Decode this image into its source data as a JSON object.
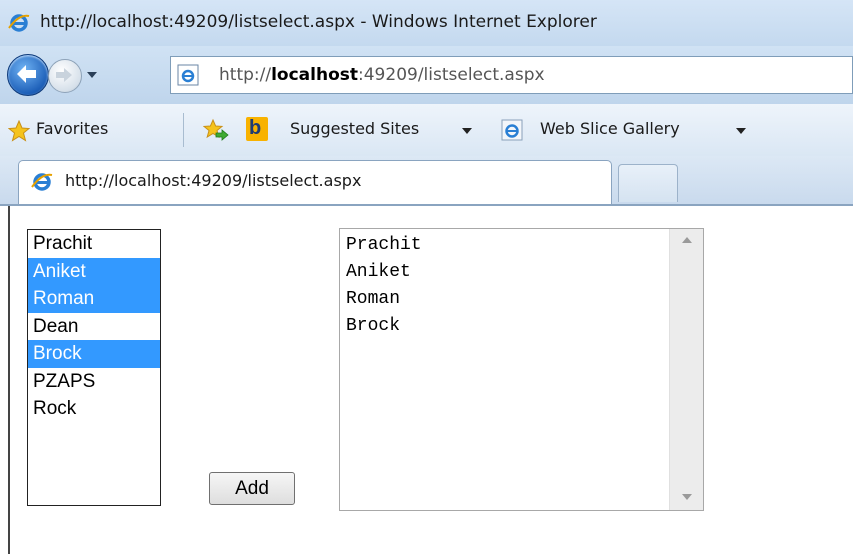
{
  "window": {
    "title": "http://localhost:49209/listselect.aspx - Windows Internet Explorer"
  },
  "address_bar": {
    "url_prefix": "http://",
    "url_host": "localhost",
    "url_suffix": ":49209/listselect.aspx"
  },
  "favorites_bar": {
    "favorites_label": "Favorites",
    "suggested_sites_label": "Suggested Sites",
    "web_slice_label": "Web Slice Gallery"
  },
  "tabs": [
    {
      "label": "http://localhost:49209/listselect.aspx",
      "active": true
    }
  ],
  "page": {
    "listbox": {
      "options": [
        {
          "label": "Prachit",
          "selected": false
        },
        {
          "label": "Aniket",
          "selected": true
        },
        {
          "label": "Roman",
          "selected": true
        },
        {
          "label": "Dean",
          "selected": false
        },
        {
          "label": "Brock",
          "selected": true
        },
        {
          "label": "PZAPS",
          "selected": false
        },
        {
          "label": "Rock",
          "selected": false
        }
      ]
    },
    "add_button_label": "Add",
    "textarea_lines": [
      "Prachit",
      "Aniket",
      "Roman",
      "Brock"
    ]
  },
  "colors": {
    "selection": "#3399ff",
    "title_bar": "#c4d9ef",
    "back_button": "#1d5fb8"
  },
  "icons": {
    "title": "ie-icon",
    "back": "back-arrow-icon",
    "forward": "forward-arrow-icon",
    "favorites": "star-icon",
    "add_favorite": "add-favorite-icon",
    "suggested_sites": "bing-icon",
    "web_slice": "ie-icon"
  }
}
